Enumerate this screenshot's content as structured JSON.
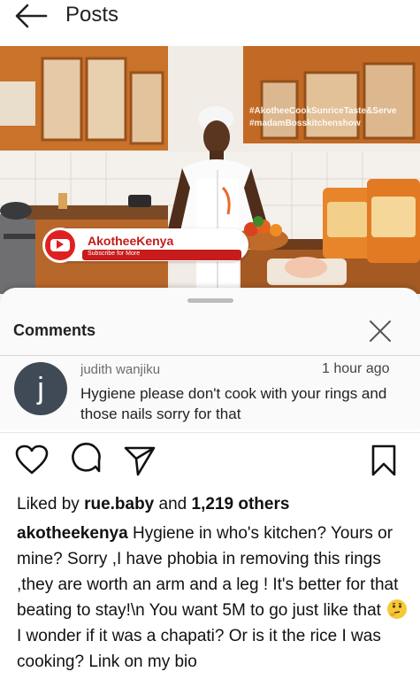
{
  "header": {
    "title": "Posts",
    "back_icon": "back-arrow-icon"
  },
  "post": {
    "hashtags": [
      "#AkotheeCookSunriceTaste&Serve",
      "#madamBosskitchenshow"
    ],
    "channel_banner": {
      "name": "AkotheeKenya",
      "subtitle": "Subscribe for More",
      "logo_icon": "youtube-icon"
    }
  },
  "comments_panel": {
    "heading": "Comments",
    "close_icon": "close-icon",
    "comments": [
      {
        "avatar_letter": "j",
        "author": "judith wanjiku",
        "time": "1 hour ago",
        "text": "Hygiene  please don't cook with your rings and those nails sorry  for that"
      }
    ]
  },
  "actions": {
    "like_icon": "heart-icon",
    "comment_icon": "comment-icon",
    "share_icon": "send-icon",
    "save_icon": "bookmark-icon"
  },
  "likes": {
    "prefix": "Liked by",
    "user": "rue.baby",
    "middle": "and",
    "others": "1,219 others"
  },
  "caption": {
    "username": "akotheekenya",
    "text_before_emoji": "Hygiene in who's kitchen? Yours or mine? Sorry ,I have phobia in removing this rings ,they are worth an arm and a leg ! It's better for that beating to stay!\\n You want 5M to go just like that",
    "emoji": "thinking-face-emoji",
    "text_after_emoji": "I wonder if it was a chapati? Or is it the rice I was cooking? Link on my bio"
  },
  "colors": {
    "accent_red": "#c81b1b",
    "avatar_bg": "#3f4a56"
  }
}
